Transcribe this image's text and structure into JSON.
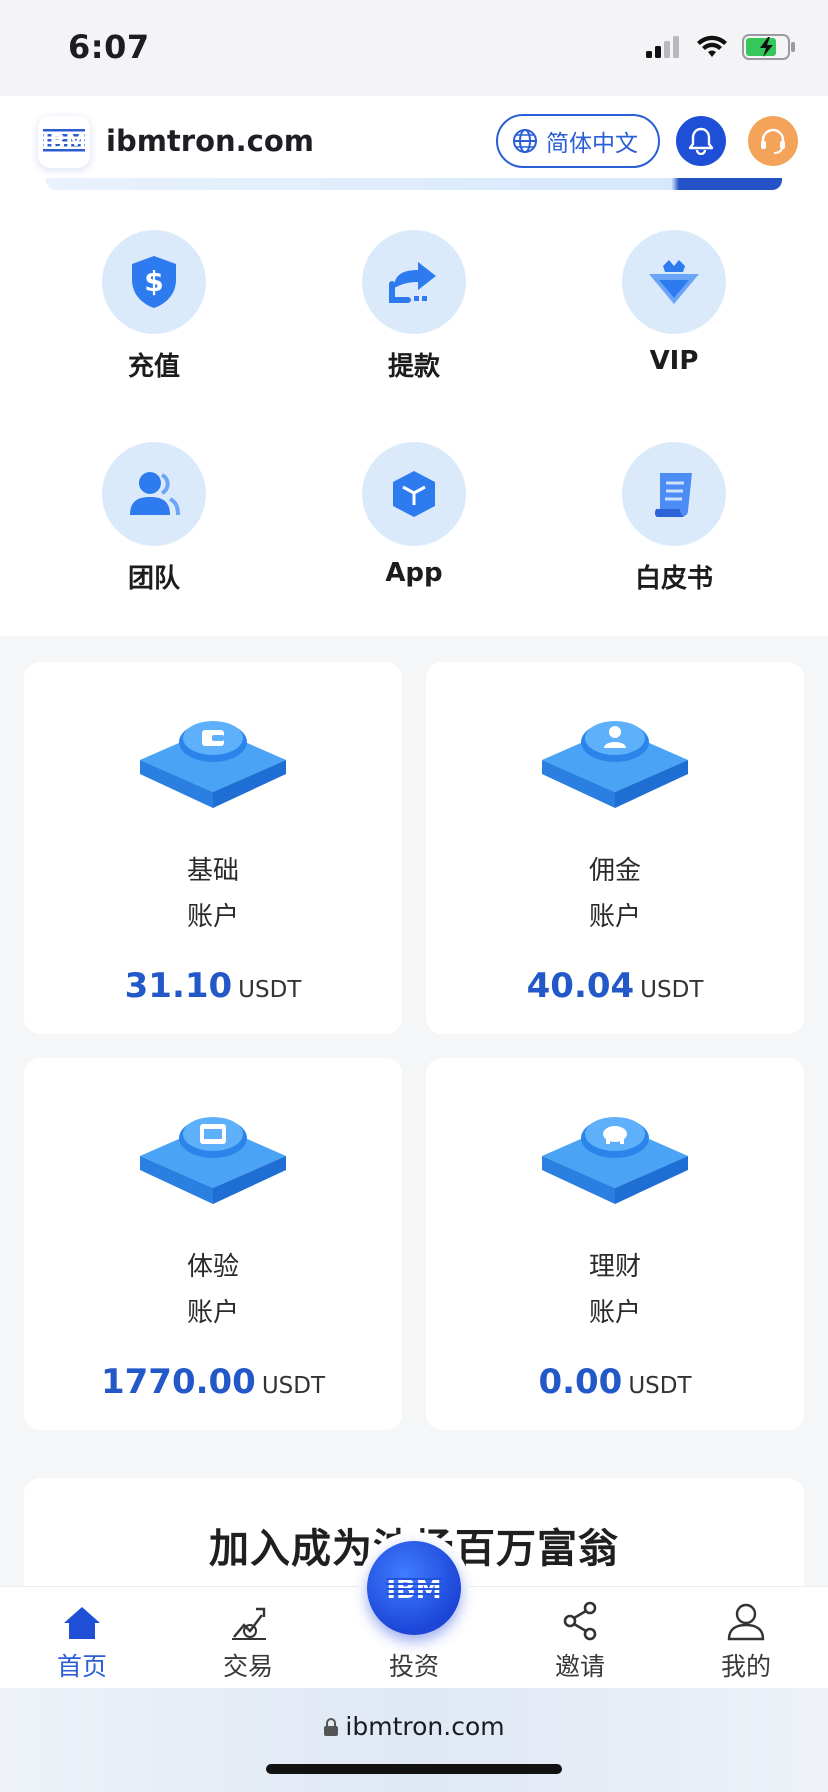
{
  "status_bar": {
    "time": "6:07"
  },
  "header": {
    "logo_text": "IBM",
    "title": "ibmtron.com",
    "language": "简体中文"
  },
  "quick_actions": [
    {
      "label": "充值",
      "icon": "dollar-shield-icon"
    },
    {
      "label": "提款",
      "icon": "withdraw-arrow-icon"
    },
    {
      "label": "VIP",
      "icon": "vip-crown-icon"
    },
    {
      "label": "团队",
      "icon": "team-users-icon"
    },
    {
      "label": "App",
      "icon": "app-cube-icon"
    },
    {
      "label": "白皮书",
      "icon": "whitepaper-scroll-icon"
    }
  ],
  "accounts": [
    {
      "name": "基础",
      "sub": "账户",
      "amount": "31.10",
      "unit": "USDT",
      "icon": "wallet-icon"
    },
    {
      "name": "佣金",
      "sub": "账户",
      "amount": "40.04",
      "unit": "USDT",
      "icon": "user-icon"
    },
    {
      "name": "体验",
      "sub": "账户",
      "amount": "1770.00",
      "unit": "USDT",
      "icon": "card-icon"
    },
    {
      "name": "理财",
      "sub": "账户",
      "amount": "0.00",
      "unit": "USDT",
      "icon": "piggy-bank-icon"
    }
  ],
  "promo": {
    "text": "加入成为波场百万富翁"
  },
  "tabs": [
    {
      "label": "首页",
      "icon": "home-icon",
      "active": true
    },
    {
      "label": "交易",
      "icon": "trade-icon",
      "active": false
    },
    {
      "label": "投资",
      "icon": "invest-ibm-icon",
      "active": false
    },
    {
      "label": "邀请",
      "icon": "share-icon",
      "active": false
    },
    {
      "label": "我的",
      "icon": "profile-icon",
      "active": false
    }
  ],
  "browser": {
    "url": "ibmtron.com"
  },
  "colors": {
    "accent": "#2a5fd6",
    "amount": "#2358c8",
    "support": "#f4a45a",
    "icon_bg": "#dbeafb"
  }
}
